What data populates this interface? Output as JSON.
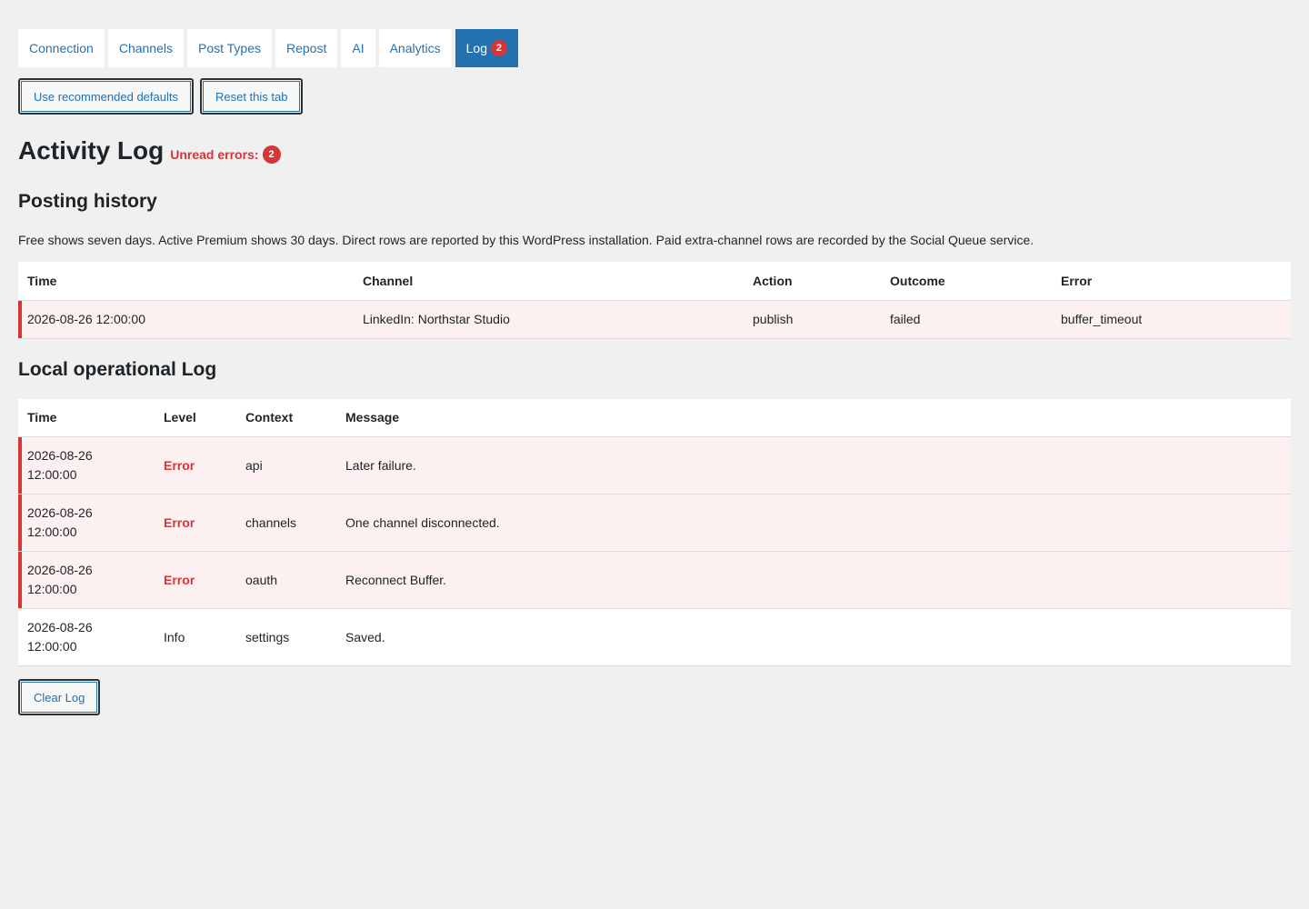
{
  "tabs": [
    {
      "label": "Connection"
    },
    {
      "label": "Channels"
    },
    {
      "label": "Post Types"
    },
    {
      "label": "Repost"
    },
    {
      "label": "AI"
    },
    {
      "label": "Analytics"
    },
    {
      "label": "Log",
      "badge": "2",
      "active": true
    }
  ],
  "actions": {
    "defaults_label": "Use recommended defaults",
    "reset_label": "Reset this tab"
  },
  "page": {
    "title": "Activity Log",
    "unread_label": "Unread errors:",
    "unread_count": "2"
  },
  "posting_history": {
    "heading": "Posting history",
    "description": "Free shows seven days. Active Premium shows 30 days. Direct rows are reported by this WordPress installation. Paid extra-channel rows are recorded by the Social Queue service.",
    "columns": [
      "Time",
      "Channel",
      "Action",
      "Outcome",
      "Error"
    ],
    "rows": [
      {
        "time": "2026-08-26 12:00:00",
        "channel": "LinkedIn: Northstar Studio",
        "action": "publish",
        "outcome": "failed",
        "error": "buffer_timeout"
      }
    ]
  },
  "local_log": {
    "heading": "Local operational Log",
    "columns": [
      "Time",
      "Level",
      "Context",
      "Message"
    ],
    "rows": [
      {
        "date": "2026-08-26",
        "clock": "12:00:00",
        "level": "Error",
        "context": "api",
        "message": "Later failure."
      },
      {
        "date": "2026-08-26",
        "clock": "12:00:00",
        "level": "Error",
        "context": "channels",
        "message": "One channel disconnected."
      },
      {
        "date": "2026-08-26",
        "clock": "12:00:00",
        "level": "Error",
        "context": "oauth",
        "message": "Reconnect Buffer."
      },
      {
        "date": "2026-08-26",
        "clock": "12:00:00",
        "level": "Info",
        "context": "settings",
        "message": "Saved."
      }
    ],
    "clear_label": "Clear Log"
  },
  "colors": {
    "accent": "#2271b1",
    "error": "#d63638",
    "error_row_bg": "#fcf0f1",
    "page_bg": "#f0f0f1"
  }
}
